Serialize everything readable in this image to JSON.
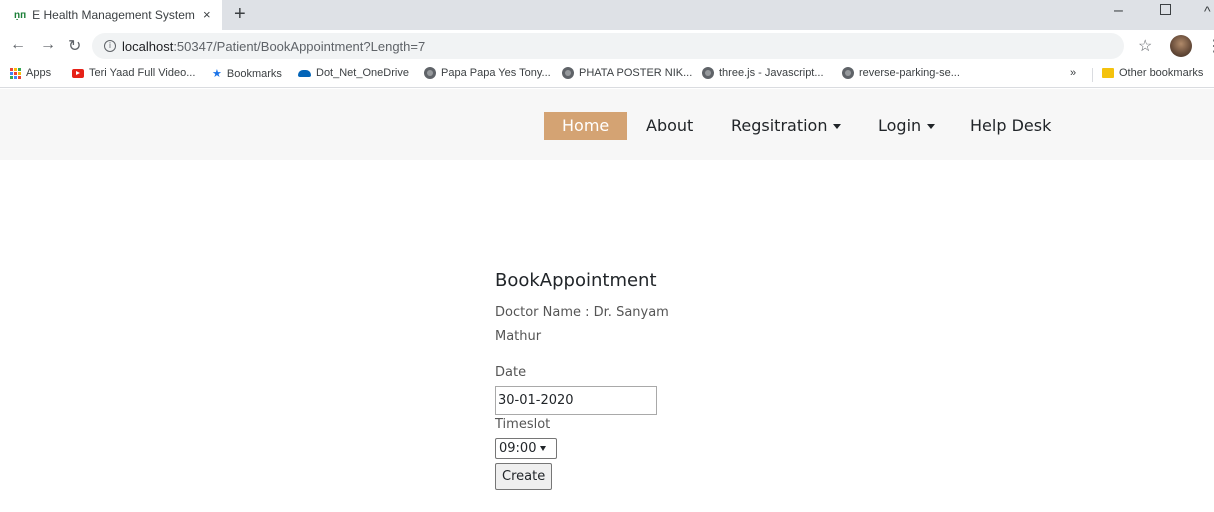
{
  "browser": {
    "tab": {
      "favicon": "ṇп",
      "title": "E Health Management System",
      "close": "×"
    },
    "new_tab": "+",
    "window_controls": {
      "minimize": "–",
      "maximize": "",
      "close": "^"
    },
    "address": {
      "host": "localhost",
      "path": ":50347/Patient/BookAppointment?Length=7",
      "info_glyph": "i"
    },
    "icons": [
      "back-arrow-icon",
      "forward-arrow-icon",
      "reload-icon",
      "info-icon",
      "star-icon",
      "avatar",
      "menu-icon"
    ]
  },
  "bookmarks": {
    "items": [
      {
        "label": "Apps",
        "icon": "apps-grid-icon"
      },
      {
        "label": "Teri Yaad Full Video...",
        "icon": "youtube-icon"
      },
      {
        "label": "Bookmarks",
        "icon": "star-icon"
      },
      {
        "label": "Dot_Net_OneDrive",
        "icon": "cloud-icon"
      },
      {
        "label": "Papa Papa Yes Tony...",
        "icon": "globe-icon"
      },
      {
        "label": "PHATA POSTER NIK...",
        "icon": "globe-icon"
      },
      {
        "label": "three.js - Javascript...",
        "icon": "globe-icon"
      },
      {
        "label": "reverse-parking-se...",
        "icon": "globe-icon"
      }
    ],
    "more": "»",
    "other": "Other bookmarks"
  },
  "nav": {
    "home": "Home",
    "about": "About",
    "registration": "Regsitration",
    "login": "Login",
    "help": "Help Desk"
  },
  "form": {
    "title": "BookAppointment",
    "doctor": "Doctor Name : Dr. Sanyam Mathur",
    "date_label": "Date",
    "date_value": "30-01-2020",
    "timeslot_label": "Timeslot",
    "timeslot_value": "09:00",
    "submit": "Create"
  },
  "colors": {
    "accent": "#d4a373",
    "navbar_bg": "#f7f7f7",
    "tabstrip_bg": "#dee1e6"
  }
}
